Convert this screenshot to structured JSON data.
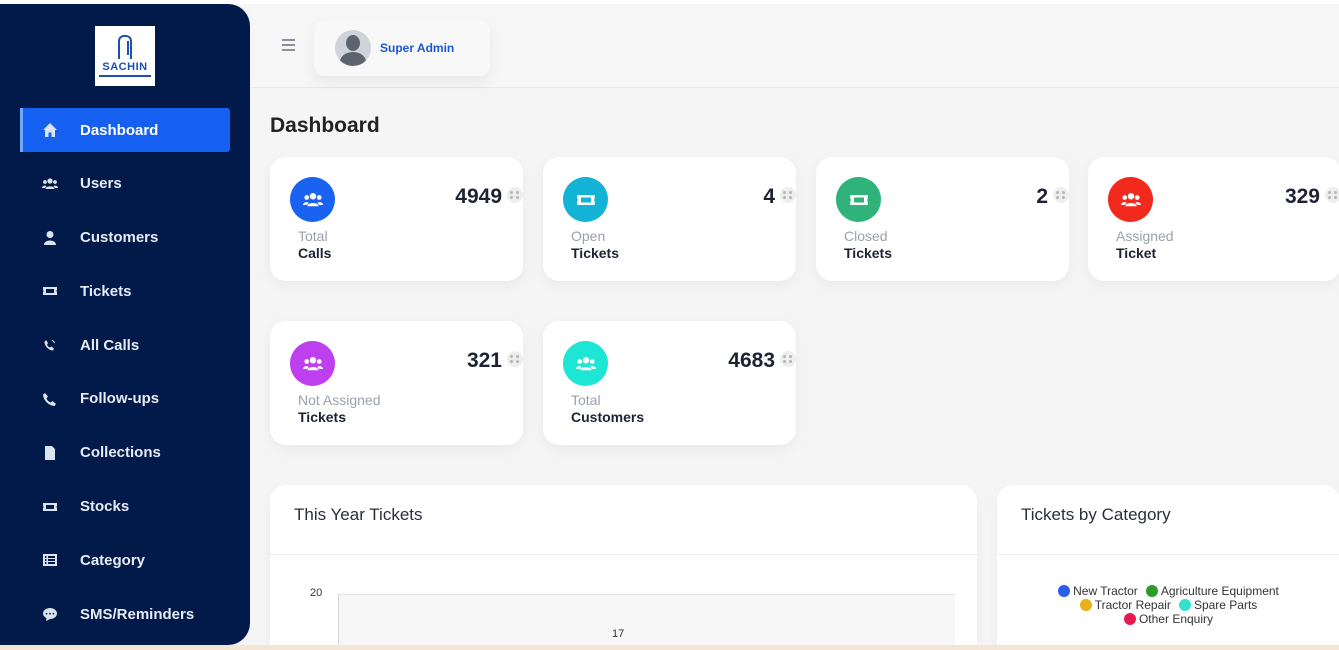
{
  "brand": {
    "logo_text": "SACHIN"
  },
  "sidebar": {
    "items": [
      {
        "label": "Dashboard",
        "icon": "home-icon",
        "active": true
      },
      {
        "label": "Users",
        "icon": "users-icon"
      },
      {
        "label": "Customers",
        "icon": "user-icon"
      },
      {
        "label": "Tickets",
        "icon": "ticket-icon"
      },
      {
        "label": "All Calls",
        "icon": "phone-volume-icon"
      },
      {
        "label": "Follow-ups",
        "icon": "phone-icon"
      },
      {
        "label": "Collections",
        "icon": "file-icon"
      },
      {
        "label": "Stocks",
        "icon": "ticket-icon"
      },
      {
        "label": "Category",
        "icon": "list-icon"
      },
      {
        "label": "SMS/Reminders",
        "icon": "sms-icon"
      }
    ]
  },
  "header": {
    "user_name": "Super Admin"
  },
  "page": {
    "title": "Dashboard"
  },
  "cards": [
    {
      "value": "4949",
      "sub": "Total",
      "main": "Calls",
      "color": "#1a63f0",
      "icon": "users-icon"
    },
    {
      "value": "4",
      "sub": "Open",
      "main": "Tickets",
      "color": "#12b3d4",
      "icon": "ticket-icon"
    },
    {
      "value": "2",
      "sub": "Closed",
      "main": "Tickets",
      "color": "#2fb37a",
      "icon": "ticket-icon"
    },
    {
      "value": "329",
      "sub": "Assigned",
      "main": "Ticket",
      "color": "#f2291d",
      "icon": "users-icon"
    },
    {
      "value": "321",
      "sub": "Not Assigned",
      "main": "Tickets",
      "color": "#bd3ff0",
      "icon": "users-icon"
    },
    {
      "value": "4683",
      "sub": "Total",
      "main": "Customers",
      "color": "#1de6d5",
      "icon": "users-icon"
    }
  ],
  "panels": {
    "year_tickets": {
      "title": "This Year Tickets"
    },
    "by_category": {
      "title": "Tickets by Category"
    }
  },
  "chart_data": [
    {
      "type": "bar",
      "title": "This Year Tickets",
      "y_tick_visible": "20",
      "data_labels": [
        "17"
      ],
      "values": [
        17
      ]
    },
    {
      "type": "pie",
      "title": "Tickets by Category",
      "legend": [
        {
          "name": "New Tractor",
          "color": "#2a5ee8"
        },
        {
          "name": "Agriculture Equipment",
          "color": "#2a9d2a"
        },
        {
          "name": "Tractor Repair",
          "color": "#e8b019"
        },
        {
          "name": "Spare Parts",
          "color": "#33e0d0"
        },
        {
          "name": "Other Enquiry",
          "color": "#e8194f"
        }
      ]
    }
  ]
}
